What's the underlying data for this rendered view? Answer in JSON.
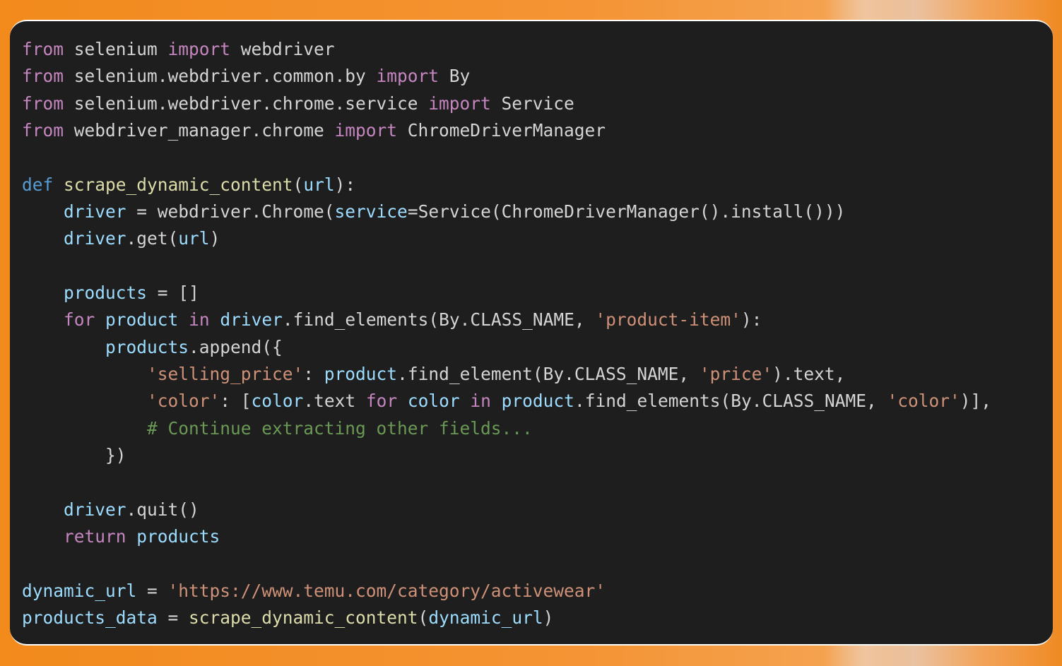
{
  "code_lines": [
    [
      {
        "t": "kw-ctrl",
        "v": "from"
      },
      {
        "t": "plain",
        "v": " selenium "
      },
      {
        "t": "kw-ctrl",
        "v": "import"
      },
      {
        "t": "plain",
        "v": " webdriver"
      }
    ],
    [
      {
        "t": "kw-ctrl",
        "v": "from"
      },
      {
        "t": "plain",
        "v": " selenium.webdriver.common.by "
      },
      {
        "t": "kw-ctrl",
        "v": "import"
      },
      {
        "t": "plain",
        "v": " By"
      }
    ],
    [
      {
        "t": "kw-ctrl",
        "v": "from"
      },
      {
        "t": "plain",
        "v": " selenium.webdriver.chrome.service "
      },
      {
        "t": "kw-ctrl",
        "v": "import"
      },
      {
        "t": "plain",
        "v": " Service"
      }
    ],
    [
      {
        "t": "kw-ctrl",
        "v": "from"
      },
      {
        "t": "plain",
        "v": " webdriver_manager.chrome "
      },
      {
        "t": "kw-ctrl",
        "v": "import"
      },
      {
        "t": "plain",
        "v": " ChromeDriverManager"
      }
    ],
    [],
    [
      {
        "t": "kw-def",
        "v": "def"
      },
      {
        "t": "plain",
        "v": " "
      },
      {
        "t": "fn",
        "v": "scrape_dynamic_content"
      },
      {
        "t": "plain",
        "v": "("
      },
      {
        "t": "var",
        "v": "url"
      },
      {
        "t": "plain",
        "v": "):"
      }
    ],
    [
      {
        "t": "plain",
        "v": "    "
      },
      {
        "t": "var",
        "v": "driver"
      },
      {
        "t": "plain",
        "v": " = webdriver.Chrome("
      },
      {
        "t": "var",
        "v": "service"
      },
      {
        "t": "plain",
        "v": "=Service(ChromeDriverManager().install()))"
      }
    ],
    [
      {
        "t": "plain",
        "v": "    "
      },
      {
        "t": "var",
        "v": "driver"
      },
      {
        "t": "plain",
        "v": ".get("
      },
      {
        "t": "var",
        "v": "url"
      },
      {
        "t": "plain",
        "v": ")"
      }
    ],
    [],
    [
      {
        "t": "plain",
        "v": "    "
      },
      {
        "t": "var",
        "v": "products"
      },
      {
        "t": "plain",
        "v": " = []"
      }
    ],
    [
      {
        "t": "plain",
        "v": "    "
      },
      {
        "t": "kw-ctrl",
        "v": "for"
      },
      {
        "t": "plain",
        "v": " "
      },
      {
        "t": "var",
        "v": "product"
      },
      {
        "t": "plain",
        "v": " "
      },
      {
        "t": "kw-ctrl",
        "v": "in"
      },
      {
        "t": "plain",
        "v": " "
      },
      {
        "t": "var",
        "v": "driver"
      },
      {
        "t": "plain",
        "v": ".find_elements(By.CLASS_NAME, "
      },
      {
        "t": "str",
        "v": "'product-item'"
      },
      {
        "t": "plain",
        "v": "):"
      }
    ],
    [
      {
        "t": "plain",
        "v": "        "
      },
      {
        "t": "var",
        "v": "products"
      },
      {
        "t": "plain",
        "v": ".append({"
      }
    ],
    [
      {
        "t": "plain",
        "v": "            "
      },
      {
        "t": "str",
        "v": "'selling_price'"
      },
      {
        "t": "plain",
        "v": ": "
      },
      {
        "t": "var",
        "v": "product"
      },
      {
        "t": "plain",
        "v": ".find_element(By.CLASS_NAME, "
      },
      {
        "t": "str",
        "v": "'price'"
      },
      {
        "t": "plain",
        "v": ").text,"
      }
    ],
    [
      {
        "t": "plain",
        "v": "            "
      },
      {
        "t": "str",
        "v": "'color'"
      },
      {
        "t": "plain",
        "v": ": ["
      },
      {
        "t": "var",
        "v": "color"
      },
      {
        "t": "plain",
        "v": ".text "
      },
      {
        "t": "kw-ctrl",
        "v": "for"
      },
      {
        "t": "plain",
        "v": " "
      },
      {
        "t": "var",
        "v": "color"
      },
      {
        "t": "plain",
        "v": " "
      },
      {
        "t": "kw-ctrl",
        "v": "in"
      },
      {
        "t": "plain",
        "v": " "
      },
      {
        "t": "var",
        "v": "product"
      },
      {
        "t": "plain",
        "v": ".find_elements(By.CLASS_NAME, "
      },
      {
        "t": "str",
        "v": "'color'"
      },
      {
        "t": "plain",
        "v": ")],"
      }
    ],
    [
      {
        "t": "plain",
        "v": "            "
      },
      {
        "t": "cmt",
        "v": "# Continue extracting other fields..."
      }
    ],
    [
      {
        "t": "plain",
        "v": "        })"
      }
    ],
    [],
    [
      {
        "t": "plain",
        "v": "    "
      },
      {
        "t": "var",
        "v": "driver"
      },
      {
        "t": "plain",
        "v": ".quit()"
      }
    ],
    [
      {
        "t": "plain",
        "v": "    "
      },
      {
        "t": "kw-ctrl",
        "v": "return"
      },
      {
        "t": "plain",
        "v": " "
      },
      {
        "t": "var",
        "v": "products"
      }
    ],
    [],
    [
      {
        "t": "var",
        "v": "dynamic_url"
      },
      {
        "t": "plain",
        "v": " = "
      },
      {
        "t": "str",
        "v": "'https://www.temu.com/category/activewear'"
      }
    ],
    [
      {
        "t": "var",
        "v": "products_data"
      },
      {
        "t": "plain",
        "v": " = "
      },
      {
        "t": "fn",
        "v": "scrape_dynamic_content"
      },
      {
        "t": "plain",
        "v": "("
      },
      {
        "t": "var",
        "v": "dynamic_url"
      },
      {
        "t": "plain",
        "v": ")"
      }
    ]
  ],
  "colors": {
    "background_orange": "#f28a1c",
    "card_background": "#1e1e1e",
    "keyword_control": "#c586c0",
    "keyword_def": "#569cd6",
    "function_name": "#dcdcaa",
    "variable": "#9cdcfe",
    "string": "#ce9178",
    "comment": "#6a9955",
    "plain_text": "#d4d4d4"
  }
}
